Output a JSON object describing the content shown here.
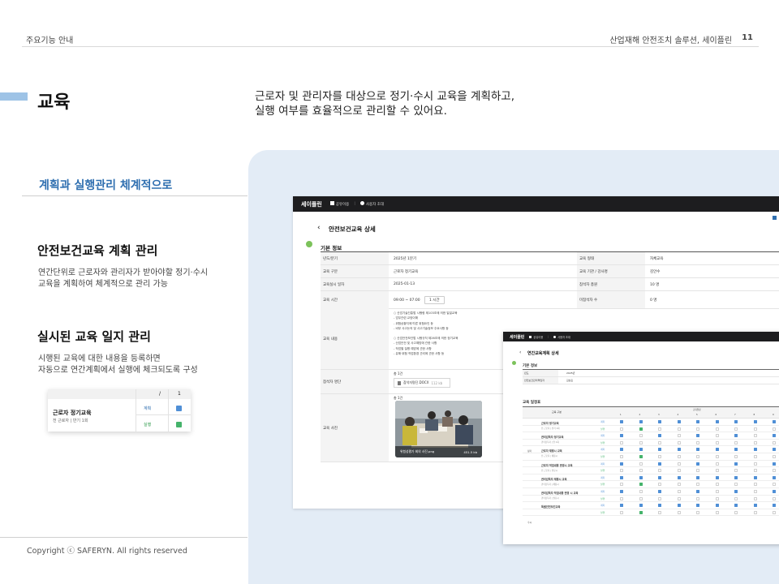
{
  "header": {
    "left": "주요기능 안내",
    "right": "산업재해 안전조치 솔루션, 세이플린",
    "page_number": "11"
  },
  "section": {
    "title": "교육",
    "description_line1": "근로자 및 관리자를 대상으로 정기·수시 교육을 계획하고,",
    "description_line2": "실행 여부를 효율적으로 관리할 수 있어요."
  },
  "subtitle": "계획과 실행관리 체계적으로",
  "features": [
    {
      "title": "안전보건교육 계획 관리",
      "desc_line1": "연간단위로 근로자와 관리자가 받아야할 정기·수시",
      "desc_line2": "교육을 계획하여 체계적으로 관리 가능"
    },
    {
      "title": "실시된 교육 일지 관리",
      "desc_line1": "시행된 교육에 대한 내용을 등록하면",
      "desc_line2": "자동으로 연간계획에서 실행에 체크되도록 구성"
    }
  ],
  "mini_card": {
    "col1": "/",
    "col2": "1",
    "name": "근로자 정기교육",
    "sub": "전 근로자 | 반기 1회",
    "plan_label": "계획",
    "done_label": "실행",
    "plan_color": "#4f8fd6",
    "done_color": "#45b36b"
  },
  "copyright": "Copyright ⓒ SAFERYN. All rights reserved",
  "app": {
    "logo": "세이플린",
    "nav_items": [
      "공유이용",
      "사용자 초대"
    ]
  },
  "detail": {
    "page_title": "안전보건교육 상세",
    "section_label": "기본 정보",
    "rows": [
      {
        "k1": "년도/분기",
        "v1": "2025년 1분기",
        "k2": "교육 형태",
        "v2": "자체교육"
      },
      {
        "k1": "교육 구분",
        "v1": "근로자 정기교육",
        "k2": "교육 기관 / 강사명",
        "v2": "김안수"
      },
      {
        "k1": "교육실시 일자",
        "v1": "2025-01-13",
        "k2": "참석자 총원",
        "v2": "10 명"
      },
      {
        "k1": "교육 시간",
        "v1": "09:00 ~ 07:00",
        "time_btn": "1 시간",
        "k2": "미참석자 수",
        "v2": "0 명"
      }
    ],
    "content_label": "교육 내용",
    "content_lines": [
      "○ 산업기술진흥법 시행령 제103조에 의한 일일교육",
      "- 업무관련 교양이해",
      "- 위험상황지에 따른 위험요인 등",
      "- 비부 사고논의 및 사고기술정보 주요사항 등",
      "",
      "○ 산업안전보건법 시행규칙 제26조에 의한 정기교육",
      "- 산업안전 및 사고예방에 관한 사항",
      "- 작업별 질병 예방에 관한 사항",
      "- 유해·위험 작업환경 관리에 관한 사항 등"
    ],
    "attendee_label": "참석자 명단",
    "attendee_count": "총 1건",
    "attendee_file": "참석자명단.DOCX",
    "attendee_size": "112 kb",
    "photo_label": "교육 사진",
    "photo_count": "총 1건",
    "photo_name": "위험성평가 회의 사진.png",
    "photo_size": "451.5 kb"
  },
  "plan": {
    "page_title": "연간교육계획 상세",
    "section_label": "기본 정보",
    "rows": [
      {
        "k": "년도",
        "v": "2025년"
      },
      {
        "k": "안전보건관리책임자",
        "v": "김상훈"
      }
    ],
    "grid_label": "교육 일정표",
    "col_label": "교육 구분",
    "months_label": "교육일정",
    "months": [
      "1",
      "2",
      "3",
      "4",
      "5",
      "6",
      "7",
      "8",
      "9"
    ],
    "group_labels": [
      "정기",
      "수시"
    ],
    "items": [
      {
        "name": "근로자 정기교육",
        "sub": "전 근로자 | 반기 1회"
      },
      {
        "name": "관리감독자 정기교육",
        "sub": "관리감독자 | 연 1회"
      },
      {
        "name": "근로자 채용시 교육",
        "sub": "전 근로자 | 채용시"
      },
      {
        "name": "근로자 작업내용 변경시 교육",
        "sub": "전 근로자 | 필요시"
      },
      {
        "name": "관리감독자 채용시 교육",
        "sub": "관리감독자 | 채용시"
      },
      {
        "name": "관리감독자 작업내용 변경 시 교육",
        "sub": "관리감독자 | 필요시"
      },
      {
        "name": "특별안전보건교육",
        "sub": ""
      }
    ],
    "plan_tag": "계획",
    "done_tag": "실행",
    "plan_color": "#4f8fd6",
    "done_color": "#45b36b"
  }
}
